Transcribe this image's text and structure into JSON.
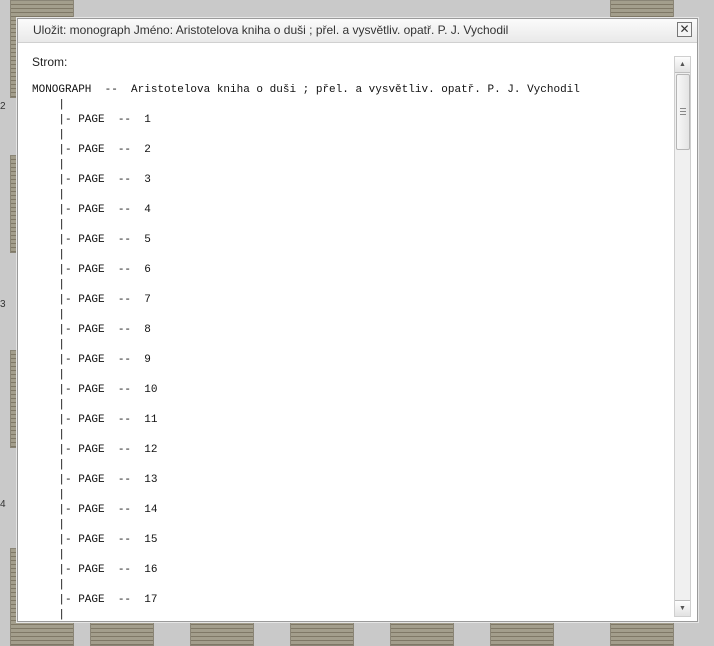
{
  "dialog": {
    "title": "Uložit: monograph Jméno: Aristotelova kniha o duši ; přel. a vysvětliv. opatř. P. J. Vychodil",
    "tree_label": "Strom:",
    "root_line": "MONOGRAPH  --  Aristotelova kniha o duši ; přel. a vysvětliv. opatř. P. J. Vychodil",
    "pages": [
      "1",
      "2",
      "3",
      "4",
      "5",
      "6",
      "7",
      "8",
      "9",
      "10",
      "11",
      "12",
      "13",
      "14",
      "15",
      "16",
      "17"
    ],
    "close_symbol": "✕"
  },
  "background": {
    "row_numbers": [
      "2",
      "3",
      "4"
    ]
  },
  "scrollbar": {
    "up_symbol": "▲",
    "down_symbol": "▼"
  }
}
